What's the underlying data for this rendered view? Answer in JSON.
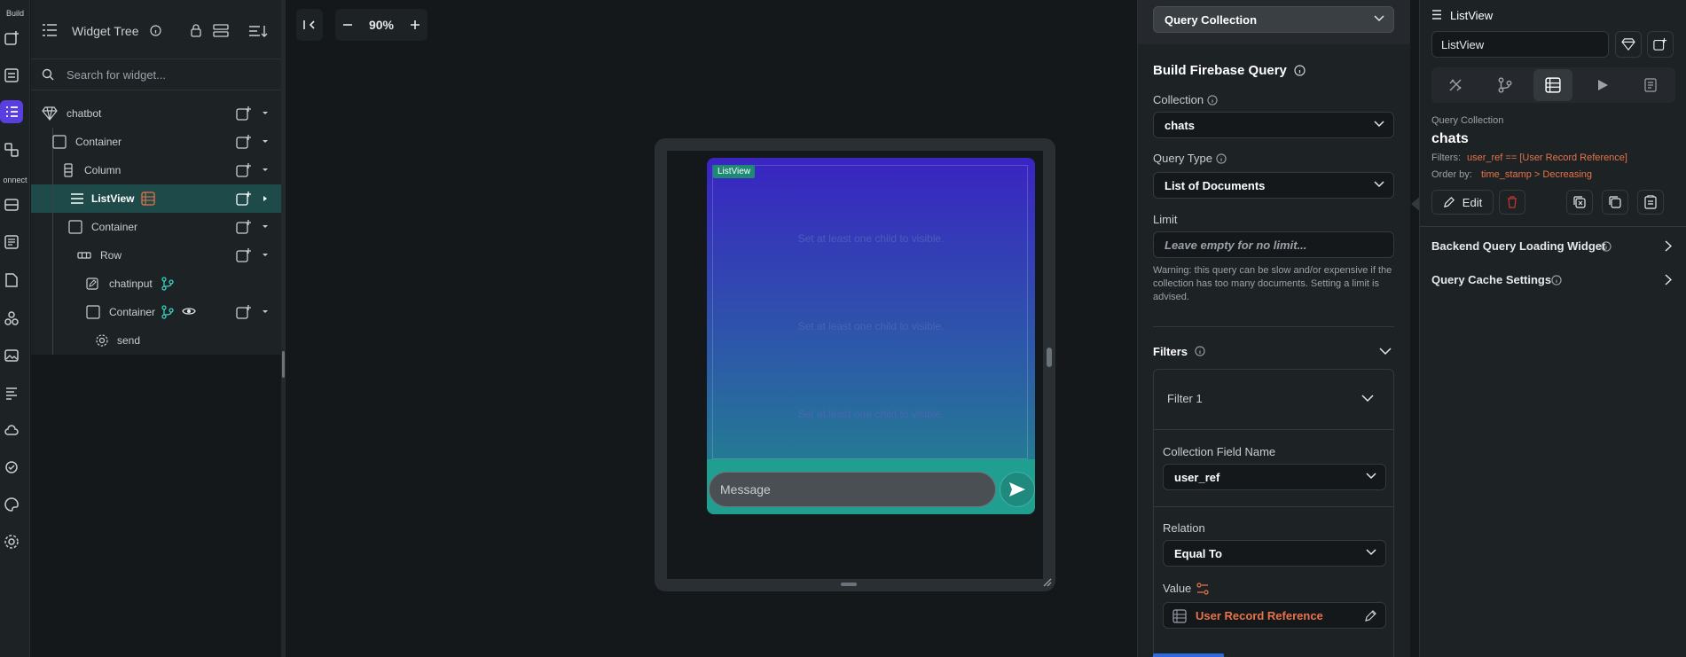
{
  "rail": {
    "build_label": "Build",
    "connect_label": "onnect"
  },
  "tree": {
    "title": "Widget Tree",
    "search_placeholder": "Search for widget...",
    "items": [
      {
        "label": "chatbot"
      },
      {
        "label": "Container"
      },
      {
        "label": "Column"
      },
      {
        "label": "ListView"
      },
      {
        "label": "Container"
      },
      {
        "label": "Row"
      },
      {
        "label": "chatinput"
      },
      {
        "label": "Container"
      },
      {
        "label": "send"
      }
    ]
  },
  "canvas": {
    "zoom": "90%",
    "listview_badge": "ListView",
    "hints": [
      "Set at least one child to visible.",
      "Set at least one child to visible.",
      "Set at least one child to visible."
    ],
    "message_placeholder": "Message"
  },
  "query": {
    "type_selected": "Query Collection",
    "section_title": "Build Firebase Query",
    "collection_label": "Collection",
    "collection_value": "chats",
    "query_type_label": "Query Type",
    "query_type_value": "List of Documents",
    "limit_label": "Limit",
    "limit_placeholder": "Leave empty for no limit...",
    "warning": "Warning: this query can be slow and/or expensive if the collection has too many documents. Setting a limit is advised.",
    "filters_label": "Filters",
    "filter": {
      "title": "Filter 1",
      "field_label": "Collection Field Name",
      "field_value": "user_ref",
      "relation_label": "Relation",
      "relation_value": "Equal To",
      "value_label": "Value",
      "value_value": "User Record Reference"
    }
  },
  "props": {
    "widget_type": "ListView",
    "widget_name": "ListView",
    "query_kind": "Query Collection",
    "collection": "chats",
    "filters_key": "Filters:",
    "filters_value": "user_ref == [User Record Reference]",
    "order_key": "Order by:",
    "order_value": "time_stamp > Decreasing",
    "edit_label": "Edit",
    "backend_loading": "Backend Query Loading Widget",
    "cache_settings": "Query Cache Settings"
  },
  "colors": {
    "accent_purple": "#5a3fe0",
    "teal_select": "#1e4a49",
    "orange_text": "#e8734a",
    "send_button": "#20897d"
  }
}
